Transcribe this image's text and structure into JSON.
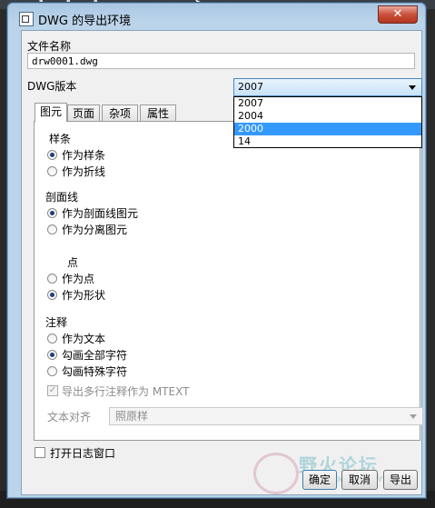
{
  "window": {
    "title": "DWG 的导出环境",
    "close_glyph": "✕"
  },
  "file": {
    "label": "文件名称",
    "value": "drw0001.dwg"
  },
  "version": {
    "label": "DWG版本",
    "selected": "2007",
    "options": [
      "2007",
      "2004",
      "2000",
      "14"
    ],
    "highlighted": "2000"
  },
  "tabs": [
    {
      "label": "图元"
    },
    {
      "label": "页面"
    },
    {
      "label": "杂项"
    },
    {
      "label": "属性"
    }
  ],
  "panel": {
    "spline": {
      "heading": "样条",
      "options": [
        {
          "label": "作为样条",
          "checked": true
        },
        {
          "label": "作为折线",
          "checked": false
        }
      ]
    },
    "hatch": {
      "heading": "剖面线",
      "options": [
        {
          "label": "作为剖面线图元",
          "checked": true
        },
        {
          "label": "作为分离图元",
          "checked": false
        }
      ]
    },
    "point": {
      "heading": "点",
      "options": [
        {
          "label": "作为点",
          "checked": false
        },
        {
          "label": "作为形状",
          "checked": true
        }
      ]
    },
    "annotation": {
      "heading": "注释",
      "options": [
        {
          "label": "作为文本",
          "checked": false
        },
        {
          "label": "勾画全部字符",
          "checked": true
        },
        {
          "label": "勾画特殊字符",
          "checked": false
        }
      ],
      "mtext_checkbox": {
        "label": "导出多行注释作为 MTEXT",
        "checked": true,
        "enabled": false
      }
    },
    "text_align": {
      "label": "文本对齐",
      "value": "照原样"
    }
  },
  "log_checkbox": {
    "label": "打开日志窗口",
    "checked": false
  },
  "buttons": {
    "ok": "确定",
    "cancel": "取消",
    "export": "导出"
  },
  "watermark": {
    "text": "野火论坛",
    "url": "www.proewildfire.cn"
  }
}
